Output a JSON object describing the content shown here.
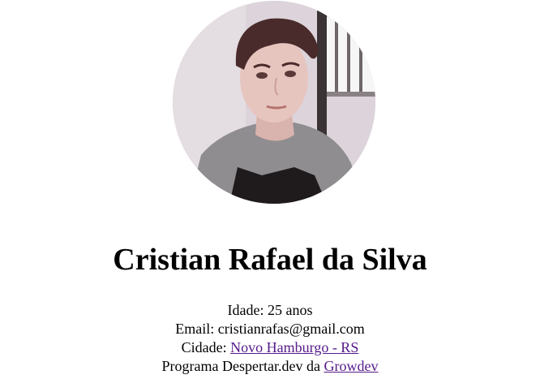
{
  "profile": {
    "name": "Cristian Rafael da Silva",
    "age_label": "Idade: 25 anos",
    "email_label": "Email: cristianrafas@gmail.com",
    "city_prefix": "Cidade: ",
    "city_link": "Novo Hamburgo - RS",
    "program_prefix": "Programa Despertar.dev da ",
    "program_link": "Growdev"
  },
  "avatar": {
    "icon": "profile-photo"
  },
  "colors": {
    "link_visited": "#551a8b",
    "text": "#000000",
    "background": "#ffffff"
  }
}
